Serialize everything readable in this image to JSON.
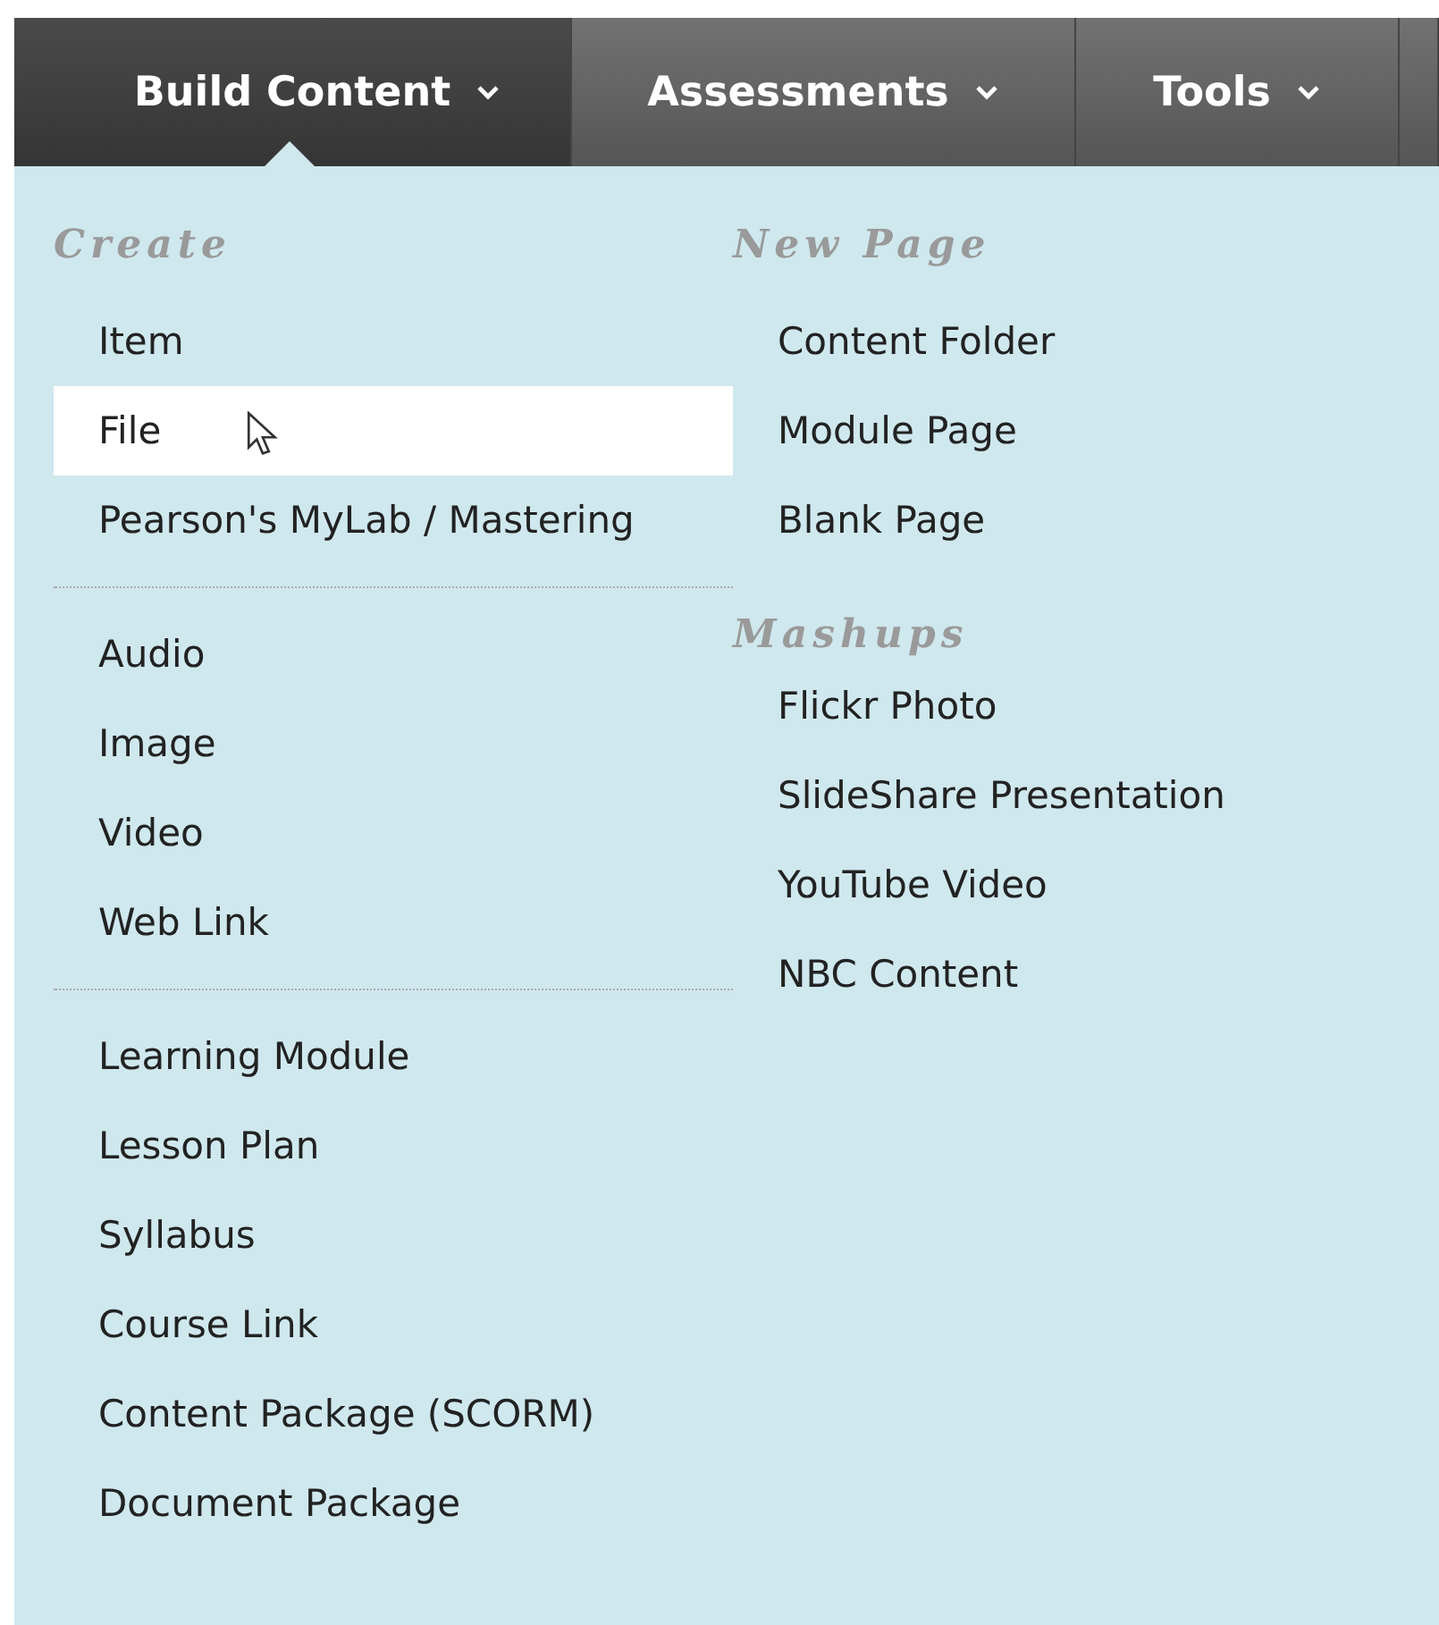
{
  "tabs": [
    {
      "label": "Build Content",
      "selected": true
    },
    {
      "label": "Assessments",
      "selected": false
    },
    {
      "label": "Tools",
      "selected": false
    }
  ],
  "menu": {
    "columns": [
      {
        "groups": [
          {
            "heading": "Create",
            "divided": false,
            "items": [
              {
                "label": "Item",
                "selected": false
              },
              {
                "label": "File",
                "selected": true
              },
              {
                "label": "Pearson's MyLab / Mastering",
                "selected": false
              }
            ]
          },
          {
            "divided": true,
            "items": [
              {
                "label": "Audio",
                "selected": false
              },
              {
                "label": "Image",
                "selected": false
              },
              {
                "label": "Video",
                "selected": false
              },
              {
                "label": "Web Link",
                "selected": false
              }
            ]
          },
          {
            "divided": true,
            "items": [
              {
                "label": "Learning Module",
                "selected": false
              },
              {
                "label": "Lesson Plan",
                "selected": false
              },
              {
                "label": "Syllabus",
                "selected": false
              },
              {
                "label": "Course Link",
                "selected": false
              },
              {
                "label": "Content Package (SCORM)",
                "selected": false
              },
              {
                "label": "Document Package",
                "selected": false
              }
            ]
          }
        ]
      },
      {
        "groups": [
          {
            "heading": "New Page",
            "divided": false,
            "items": [
              {
                "label": "Content Folder",
                "selected": false
              },
              {
                "label": "Module Page",
                "selected": false
              },
              {
                "label": "Blank Page",
                "selected": false
              }
            ]
          },
          {
            "heading": "Mashups",
            "divided": false,
            "items": [
              {
                "label": "Flickr Photo",
                "selected": false
              },
              {
                "label": "SlideShare Presentation",
                "selected": false
              },
              {
                "label": "YouTube Video",
                "selected": false
              },
              {
                "label": "NBC Content",
                "selected": false
              }
            ]
          }
        ]
      }
    ]
  }
}
